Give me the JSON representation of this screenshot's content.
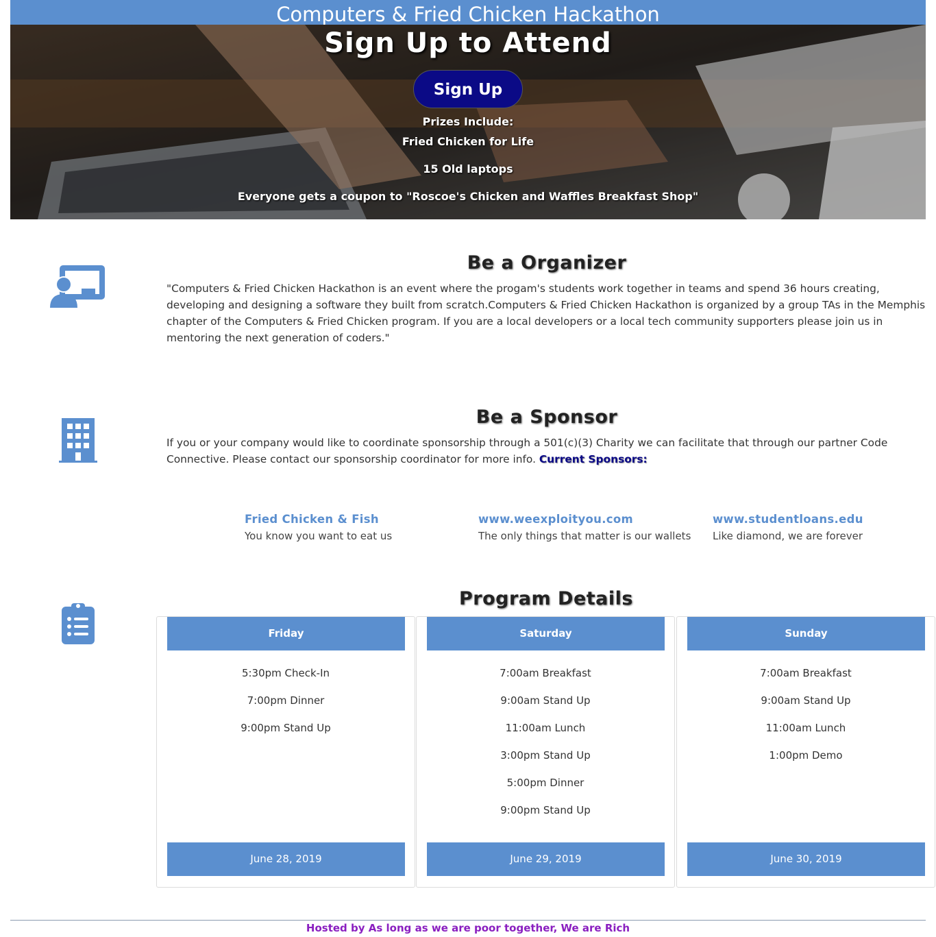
{
  "header": {
    "title": "Computers & Fried Chicken Hackathon"
  },
  "hero": {
    "title": "Sign Up to Attend",
    "signup_label": "Sign Up",
    "prizes_heading": "Prizes Include:",
    "prizes": [
      "Fried Chicken for Life",
      "15 Old laptops",
      "Everyone gets a coupon to \"Roscoe's Chicken and Waffles Breakfast Shop\""
    ]
  },
  "organizer": {
    "icon": "presentation-person-icon",
    "title": "Be a Organizer",
    "text": "\"Computers & Fried Chicken Hackathon is an event where the progam's students work together in teams and spend 36 hours creating, developing and designing a software they built from scratch.Computers & Fried Chicken Hackathon is organized by a group TAs in the Memphis chapter of the Computers & Fried Chicken program. If you are a local developers or a local tech community supporters please join us in mentoring the next generation of coders.\""
  },
  "sponsor": {
    "icon": "building-icon",
    "title": "Be a Sponsor",
    "text": "If you or your company would like to coordinate sponsorship through a 501(c)(3) Charity we can facilitate that through our partner Code Connective. Please contact our sponsorship coordinator for more info.",
    "current_label": "Current Sponsors:",
    "sponsors": [
      {
        "name": "Fried Chicken & Fish",
        "tagline": "You know you want to eat us"
      },
      {
        "name": "www.weexploityou.com",
        "tagline": "The only things that matter is our wallets"
      },
      {
        "name": "www.studentloans.edu",
        "tagline": "Like diamond, we are forever"
      }
    ]
  },
  "program": {
    "icon": "clipboard-list-icon",
    "title": "Program Details",
    "days": [
      {
        "day": "Friday",
        "date": "June 28, 2019",
        "items": [
          "5:30pm Check-In",
          "7:00pm Dinner",
          "9:00pm Stand Up"
        ]
      },
      {
        "day": "Saturday",
        "date": "June 29, 2019",
        "items": [
          "7:00am Breakfast",
          "9:00am Stand Up",
          "11:00am Lunch",
          "3:00pm Stand Up",
          "5:00pm Dinner",
          "9:00pm Stand Up"
        ]
      },
      {
        "day": "Sunday",
        "date": "June 30, 2019",
        "items": [
          "7:00am Breakfast",
          "9:00am Stand Up",
          "11:00am Lunch",
          "1:00pm Demo"
        ]
      }
    ]
  },
  "footer": {
    "text": "Hosted by As long as we are poor together, We are Rich"
  },
  "colors": {
    "accent": "#5b8fcf",
    "button": "#0b0a86",
    "footer_text": "#8a1fc0"
  }
}
